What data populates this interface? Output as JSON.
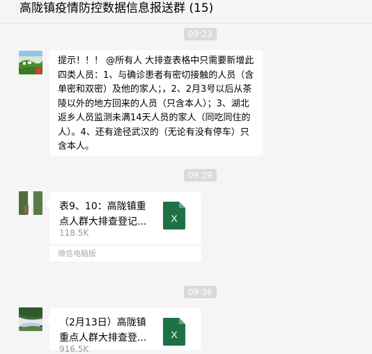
{
  "header": {
    "title": "高陇镇疫情防控数据信息报送群 (15)"
  },
  "messages": [
    {
      "time": "09:23",
      "avatar_icon": "landscape-avatar-icon",
      "type": "text",
      "text": "提示！！！ @所有人 大排查表格中只需要新增此四类人员：1、与确诊患者有密切接触的人员（含单密和双密）及他的家人；，2、2月3号以后从茶陵以外的地方回来的人员（只含本人）；3、湖北返乡人员监测未满14天人员的家人（同吃同住的人）。4、还有途径武汉的（无论有没有停车）只含本人。"
    },
    {
      "time": "09:29",
      "avatar_icon": "waterfall-avatar-icon",
      "type": "file",
      "file_name": "表9、10：高陇镇重点人群大排查登记...",
      "file_size": "118.5K",
      "file_icon": "excel-file-icon",
      "file_icon_letter": "X",
      "footer": "微信电脑版"
    },
    {
      "time": "09:36",
      "avatar_icon": "stream-avatar-icon",
      "type": "file",
      "file_name": "（2月13日）高陇镇重点人群大排查登...",
      "file_size": "916.5K",
      "file_icon": "excel-file-icon",
      "file_icon_letter": "X"
    }
  ],
  "colors": {
    "background": "#f5f5f5",
    "bubble": "#ffffff",
    "time_badge": "#dadada",
    "excel_green": "#1e7145"
  }
}
